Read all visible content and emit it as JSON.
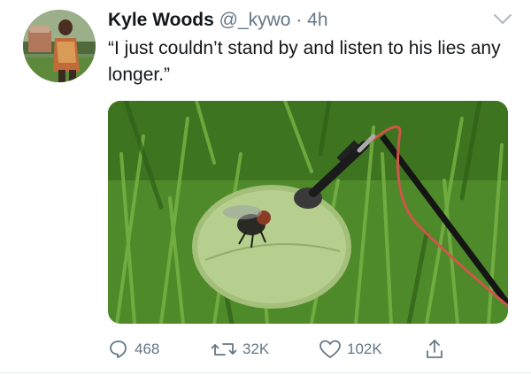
{
  "tweet": {
    "author_name": "Kyle Woods",
    "author_handle": "@_kywo",
    "separator": "·",
    "time": "4h",
    "text": "“I just couldn’t stand by and listen to his lies any longer.”"
  },
  "actions": {
    "reply_count": "468",
    "retweet_count": "32K",
    "like_count": "102K"
  },
  "icons": {
    "menu": "chevron-down-icon",
    "reply": "reply-icon",
    "retweet": "retweet-icon",
    "like": "heart-icon",
    "share": "share-icon"
  },
  "colors": {
    "text": "#14171a",
    "secondary": "#657786",
    "divider": "#e1e8ed"
  }
}
